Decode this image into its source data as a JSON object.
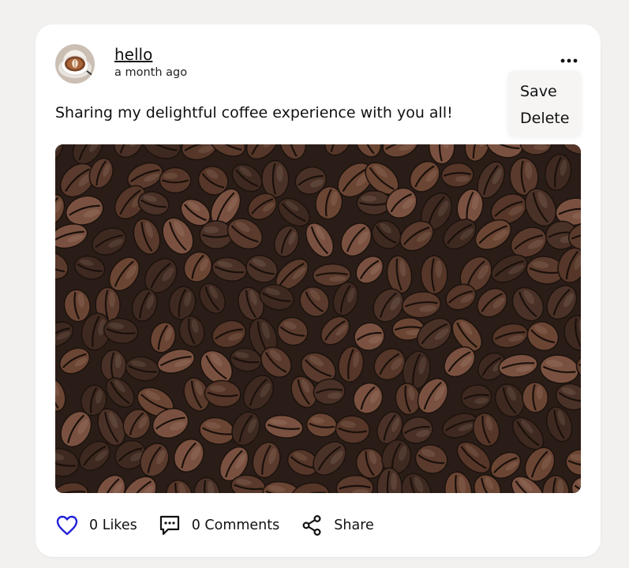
{
  "post": {
    "author": "hello",
    "timestamp": "a month ago",
    "text": "Sharing my delightful coffee experience with you all!",
    "menu": {
      "save_label": "Save",
      "delete_label": "Delete"
    },
    "actions": {
      "likes_label": "0 Likes",
      "comments_label": "0 Comments",
      "share_label": "Share"
    }
  },
  "icons": {
    "like": "heart-outline-icon",
    "comment": "comment-bubble-icon",
    "share": "share-icon",
    "more": "more-horizontal-icon"
  },
  "colors": {
    "like_icon": "#2121d8",
    "background": "#f2f1ef",
    "card": "#ffffff",
    "menu": "#f6f5f4"
  }
}
